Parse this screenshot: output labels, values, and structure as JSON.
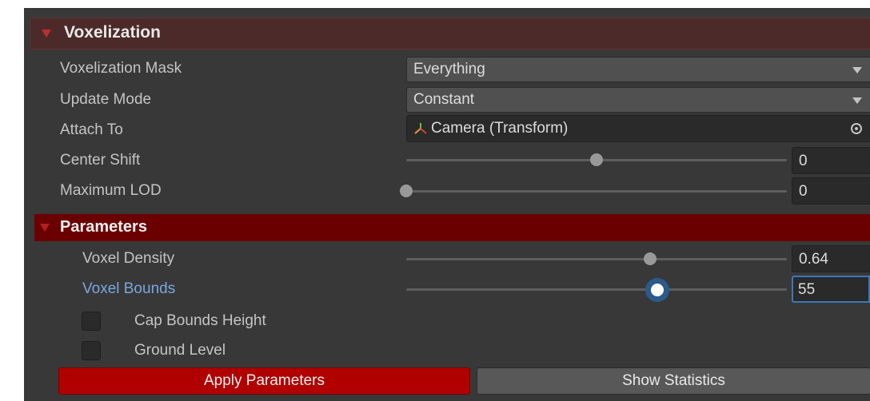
{
  "section": {
    "title": "Voxelization"
  },
  "fields": {
    "voxelization_mask": {
      "label": "Voxelization Mask",
      "value": "Everything"
    },
    "update_mode": {
      "label": "Update Mode",
      "value": "Constant"
    },
    "attach_to": {
      "label": "Attach To",
      "value": "Camera (Transform)",
      "icon": "transform-axes-icon"
    },
    "center_shift": {
      "label": "Center Shift",
      "value": "0",
      "slider_fraction": 0.5
    },
    "maximum_lod": {
      "label": "Maximum LOD",
      "value": "0",
      "slider_fraction": 0.0
    }
  },
  "parameters": {
    "title": "Parameters",
    "voxel_density": {
      "label": "Voxel Density",
      "value": "0.64",
      "slider_fraction": 0.64
    },
    "voxel_bounds": {
      "label": "Voxel Bounds",
      "value": "55",
      "slider_fraction": 0.66
    },
    "cap_bounds_height": {
      "label": "Cap Bounds Height",
      "checked": false
    },
    "ground_level": {
      "label": "Ground Level",
      "checked": false
    }
  },
  "buttons": {
    "apply": "Apply Parameters",
    "stats": "Show Statistics"
  },
  "colors": {
    "header_bg": "#4d2a2a",
    "params_bar": "#6b0000",
    "apply_button": "#b00000",
    "focus_accent": "#3a79bb",
    "focused_label": "#7aa7e0"
  }
}
